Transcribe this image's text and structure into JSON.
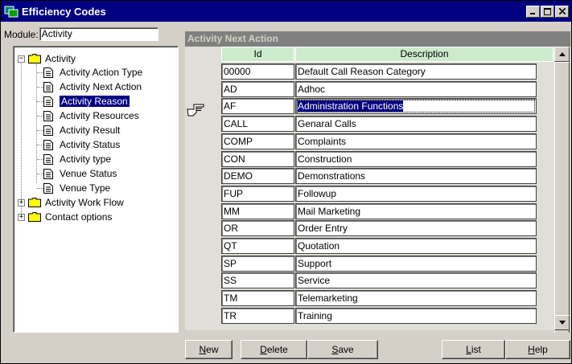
{
  "window": {
    "title": "Efficiency Codes"
  },
  "module": {
    "label": "Module:",
    "value": "Activity"
  },
  "tree": {
    "root": "Activity",
    "children": [
      "Activity Action  Type",
      "Activity Next Action",
      "Activity Reason",
      "Activity Resources",
      "Activity Result",
      "Activity Status",
      "Activity type",
      "Venue Status",
      "Venue Type"
    ],
    "selected": "Activity Reason",
    "others": [
      "Activity Work Flow",
      "Contact options"
    ]
  },
  "grid": {
    "title": "Activity Next Action",
    "columns": [
      "Id",
      "Description"
    ],
    "rows": [
      {
        "id": "00000",
        "description": "Default Call Reason Category"
      },
      {
        "id": "AD",
        "description": "Adhoc"
      },
      {
        "id": "AF",
        "description": "Administration Functions"
      },
      {
        "id": "CALL",
        "description": "Genaral Calls"
      },
      {
        "id": "COMP",
        "description": "Complaints"
      },
      {
        "id": "CON",
        "description": "Construction"
      },
      {
        "id": "DEMO",
        "description": "Demonstrations"
      },
      {
        "id": "FUP",
        "description": "Followup"
      },
      {
        "id": "MM",
        "description": "Mail Marketing"
      },
      {
        "id": "OR",
        "description": "Order Entry"
      },
      {
        "id": "QT",
        "description": "Quotation"
      },
      {
        "id": "SP",
        "description": "Support"
      },
      {
        "id": "SS",
        "description": "Service"
      },
      {
        "id": "TM",
        "description": "Telemarketing"
      },
      {
        "id": "TR",
        "description": "Training"
      }
    ],
    "current_row": "AF"
  },
  "buttons": {
    "new": {
      "accel": "N",
      "rest": "ew"
    },
    "delete": {
      "accel": "D",
      "rest": "elete"
    },
    "save": {
      "accel": "S",
      "rest": "ave"
    },
    "list": {
      "accel": "L",
      "rest": "ist"
    },
    "help": {
      "accel": "H",
      "rest": "elp"
    }
  },
  "colors": {
    "title_bar": "#000080",
    "header_green": "#ccebcc",
    "selection": "#000080"
  },
  "icons": {
    "app": "app-icon",
    "minimize": "minimize-icon",
    "maximize": "maximize-icon",
    "close": "close-icon",
    "row_pointer": "pointing-hand-icon"
  }
}
